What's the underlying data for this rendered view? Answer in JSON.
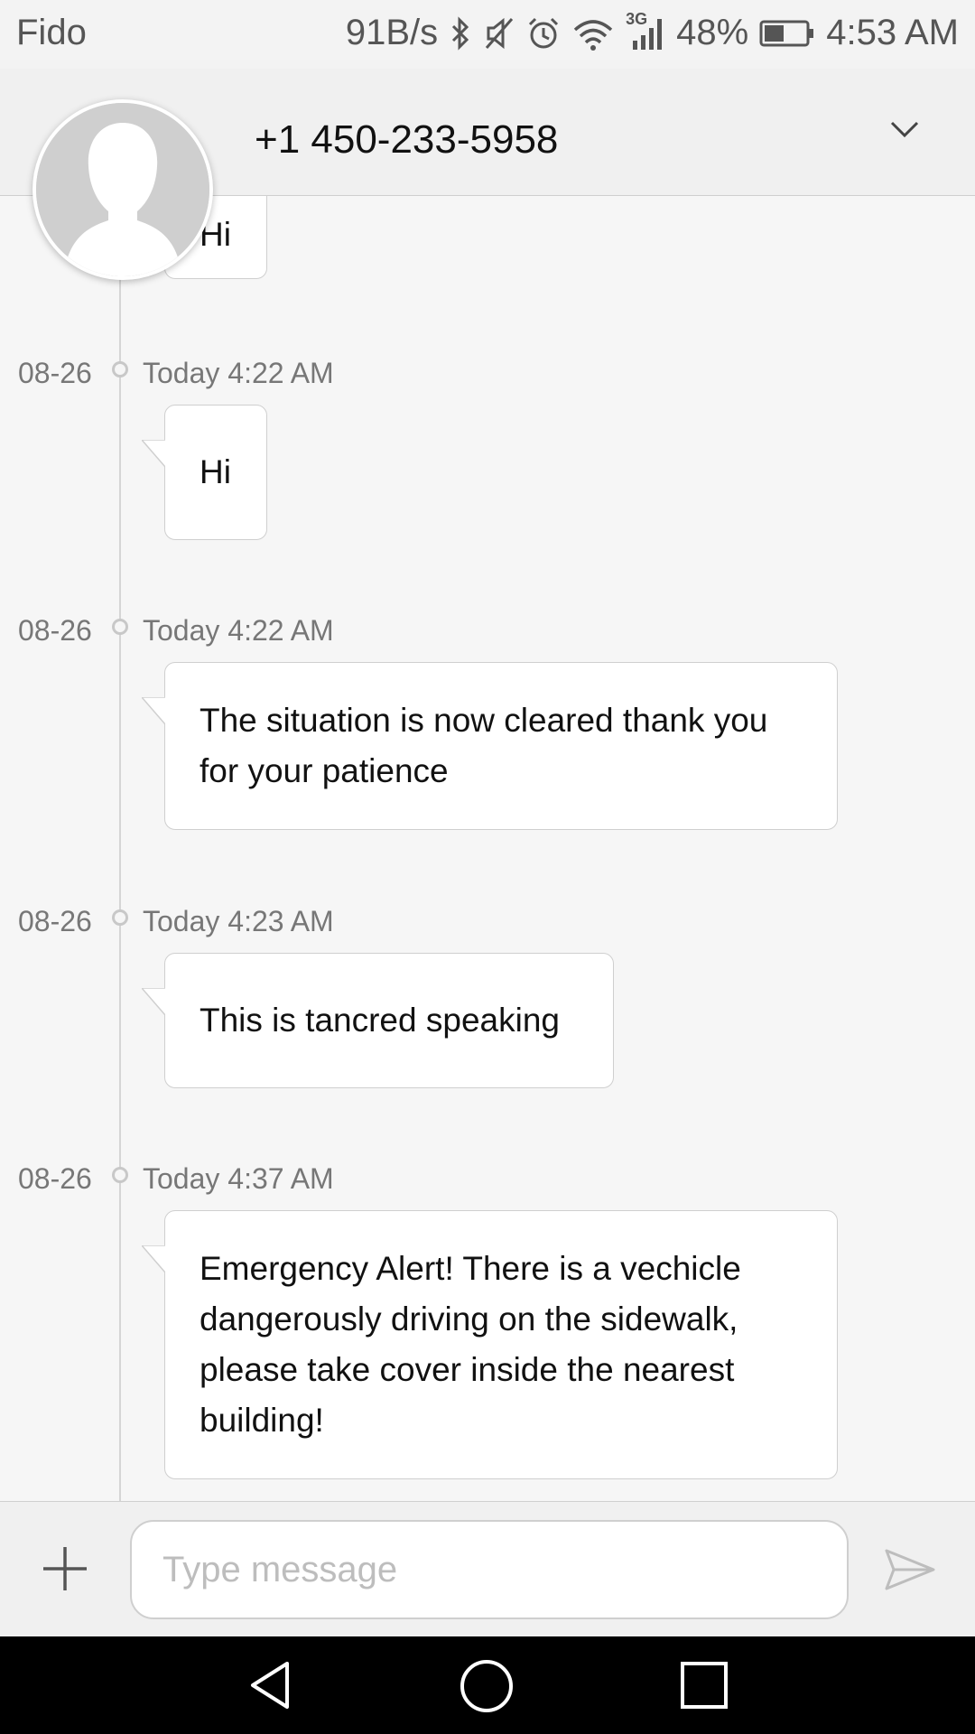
{
  "status_bar": {
    "carrier": "Fido",
    "net_speed": "91B/s",
    "network": "3G",
    "battery": "48%",
    "time": "4:53 AM",
    "icons": [
      "bluetooth-icon",
      "mute-icon",
      "alarm-icon",
      "wifi-icon",
      "signal-icon",
      "battery-icon"
    ]
  },
  "header": {
    "contact": "+1 450-233-5958"
  },
  "messages": [
    {
      "text": "Hi"
    },
    {
      "date": "08-26",
      "time": "Today 4:22 AM",
      "text": "Hi"
    },
    {
      "date": "08-26",
      "time": "Today 4:22 AM",
      "lines": [
        "The situation is now cleared thank you",
        "for your patience"
      ]
    },
    {
      "date": "08-26",
      "time": "Today 4:23 AM",
      "text": "This is tancred speaking"
    },
    {
      "date": "08-26",
      "time": "Today 4:37 AM",
      "lines": [
        "Emergency Alert! There is a vechicle",
        "dangerously driving on the sidewalk,",
        "please take cover inside the nearest",
        "building!"
      ]
    }
  ],
  "input": {
    "placeholder": "Type message"
  },
  "colors": {
    "background": "#f6f6f6",
    "bubble": "#ffffff",
    "muted_text": "#777777"
  }
}
